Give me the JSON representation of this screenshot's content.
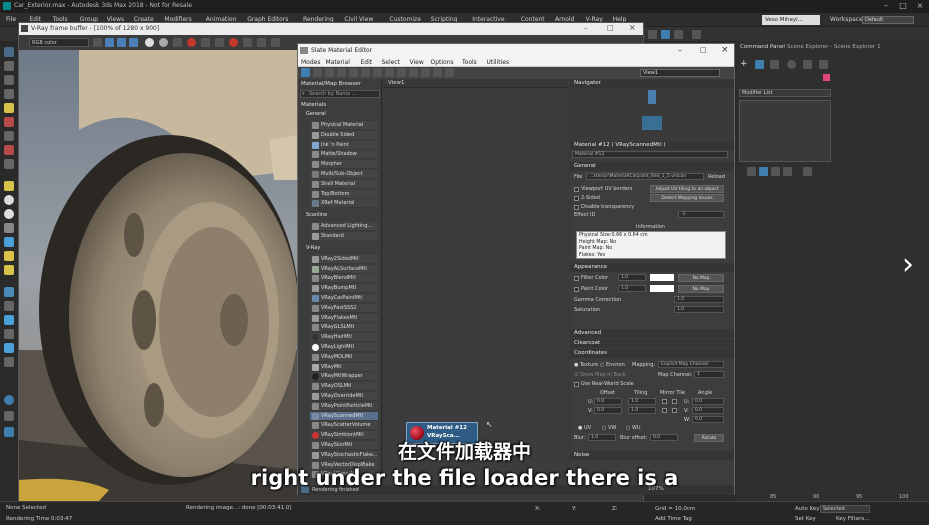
{
  "app": {
    "title": "Car_Exterior.max - Autodesk 3ds Max 2018 - Not for Resale",
    "menu": [
      "File",
      "Edit",
      "Tools",
      "Group",
      "Views",
      "Create",
      "Modifiers",
      "Animation",
      "Graph Editors",
      "Rendering",
      "Civil View",
      "Customize",
      "Scripting",
      "Interactive",
      "Content",
      "Arnold",
      "V-Ray",
      "Help"
    ],
    "user": "Veso Mihayl...",
    "workspaces_label": "Workspaces:",
    "workspaces_value": "Default"
  },
  "vfb": {
    "title": "V-Ray frame buffer - [100% of 1280 x 900]",
    "channel": "RGB color"
  },
  "sme": {
    "title": "Slate Material Editor",
    "menu": [
      "Modes",
      "Material",
      "Edit",
      "Select",
      "View",
      "Options",
      "Tools",
      "Utilities"
    ],
    "view_selector": "View1",
    "view_tab": "View1",
    "navigator_title": "Navigator",
    "browser": {
      "title": "Material/Map Browser",
      "search_placeholder": "Search by Name ...",
      "root": "Materials",
      "groups": [
        {
          "name": "General",
          "items": [
            "Physical Material",
            "Double Sided",
            "Ink 'n Paint",
            "Matte/Shadow",
            "Morpher",
            "Multi/Sub-Object",
            "Shell Material",
            "Top/Bottom",
            "XRef Material"
          ]
        },
        {
          "name": "Scanline",
          "items": [
            "Advanced Lighting...",
            "Standard"
          ]
        },
        {
          "name": "V-Ray",
          "items": [
            "VRay2SidedMtl",
            "VRayALSurfaceMtl",
            "VRayBlendMtl",
            "VRayBumpMtl",
            "VRayCarPaintMtl",
            "VRayFastSSS2",
            "VRayFlakesMtl",
            "VRayGLSLMtl",
            "VRayHairMtl",
            "VRayLightMtl",
            "VRayMDLMtl",
            "VRayMtl",
            "VRayMtlWrapper",
            "VRayOSLMtl",
            "VRayOverrideMtl",
            "VRayPointParticleMtl",
            "VRayScannedMtl",
            "VRayScatterVolume",
            "VRaySimbiontMtl",
            "VRaySkinMtl",
            "VRayStochasticFlake...",
            "VRayVectorDisplBake",
            "VRayVRmatMtl"
          ]
        }
      ],
      "selected_item": "VRayScannedMtl"
    },
    "node": {
      "title": "Material #12",
      "subtitle": "VRaySca..."
    },
    "rendering_status": "Rendering finished",
    "zoom": "107%"
  },
  "params": {
    "header": "Material #12  ( VRayScannedMtl )",
    "name": "Material #12",
    "general": "General",
    "file_label": "File",
    "file_value": "...xterior\\Material\\Carpaint_Red_1_5.vrscan",
    "reload": "Reload",
    "viewport_uv": "Viewport UV borders",
    "adjust_uv": "Adjust UV tiling to an object",
    "two_sided": "2-Sided",
    "detect_mapping": "Detect Mapping Issues",
    "disable_transparency": "Disable transparency",
    "effect_id_label": "Effect ID",
    "effect_id": "-1",
    "information": "Information",
    "info_lines": [
      "Physical Size:0.66 x 0.64 cm",
      "Height Map: No",
      "Paint Map: No",
      "Flakes: Yes"
    ],
    "appearance": "Appearance",
    "filter_color": "Filter Color",
    "paint_color": "Paint Color",
    "filter_val": "1.0",
    "paint_val": "1.0",
    "no_map": "No Map",
    "gamma_label": "Gamma Correction",
    "gamma": "1.0",
    "saturation_label": "Saturation",
    "saturation": "1.0",
    "advanced": "Advanced",
    "clearcoat": "Clearcoat",
    "coordinates": "Coordinates",
    "texture": "Texture",
    "environ": "Environ",
    "mapping_label": "Mapping:",
    "mapping_value": "Explicit Map Channel",
    "show_map": "Show Map in Back",
    "map_channel_label": "Map Channel:",
    "map_channel": "1",
    "real_world": "Use Real-World Scale",
    "col_offset": "Offset",
    "col_tiling": "Tiling",
    "col_mirror": "Mirror Tile",
    "col_angle": "Angle",
    "row_u": "U:",
    "row_v": "V:",
    "row_w": "W:",
    "u_offset": "0.0",
    "v_offset": "0.0",
    "u_tiling": "1.0",
    "v_tiling": "1.0",
    "u_angle": "0.0",
    "v_angle": "0.0",
    "w_angle": "0.0",
    "uv": "UV",
    "vw": "VW",
    "wu": "WU",
    "blur_label": "Blur:",
    "blur": "1.0",
    "blur_offset_label": "Blur offset:",
    "blur_offset": "0.0",
    "rotate": "Rotate",
    "noise": "Noise"
  },
  "cmd": {
    "tabs": [
      "Command Panel",
      "Scene Explorer - Scene Explorer 1"
    ],
    "modifier_list": "Modifier List"
  },
  "status": {
    "selection": "None Selected",
    "render_time": "Rendering Time  0:03:47",
    "render_msg": "Rendering image...: done [00:03:41.0]",
    "x_label": "X:",
    "y_label": "Y:",
    "z_label": "Z:",
    "grid": "Grid = 10,0cm",
    "add_time_tag": "Add Time Tag",
    "auto_key": "Auto Key",
    "set_key": "Set Key",
    "selected": "Selected",
    "key_filters": "Key Filters...",
    "timeline_ticks": [
      "85",
      "90",
      "95",
      "100"
    ]
  },
  "subtitle": {
    "cn": "在文件加载器中",
    "en": "right under the file loader there is a"
  },
  "colors": {
    "accent": "#2f5c84",
    "selection": "#5a6f8c",
    "subtitle": "#ffffff"
  }
}
